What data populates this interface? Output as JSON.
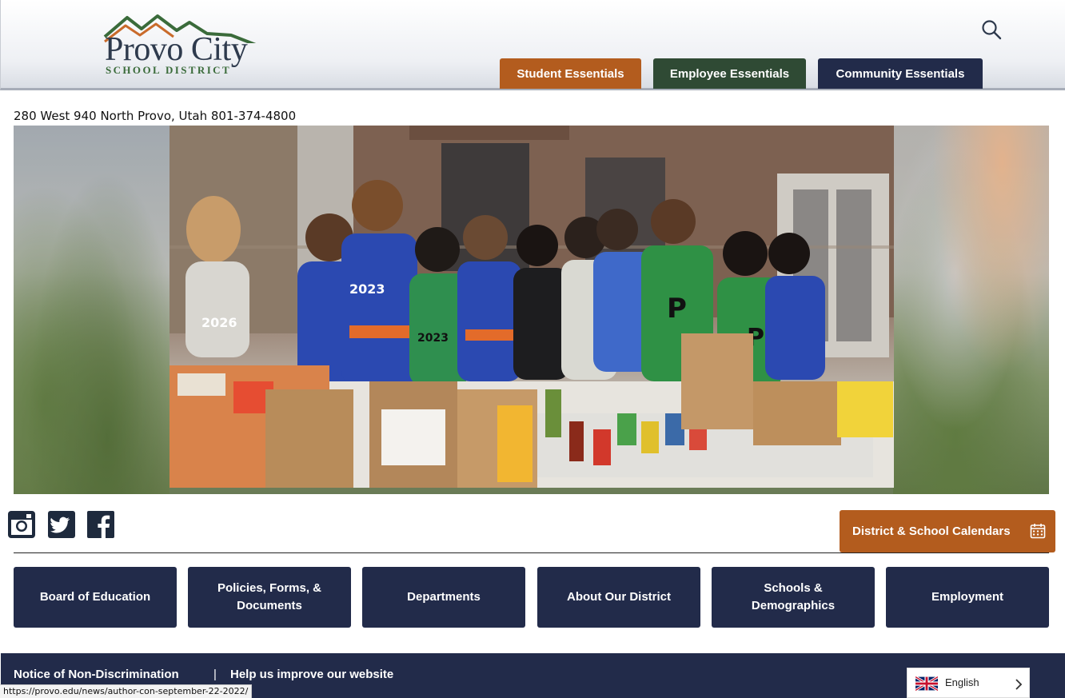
{
  "header": {
    "logo_title": "Provo City",
    "logo_subtitle": "SCHOOL DISTRICT",
    "search_icon": "search-icon",
    "tabs": [
      {
        "label": "Student Essentials",
        "color": "#b35c1e"
      },
      {
        "label": "Employee Essentials",
        "color": "#2f4a34"
      },
      {
        "label": "Community Essentials",
        "color": "#222b4a"
      }
    ]
  },
  "address": "280 West 940 North Provo, Utah 801-374-4800",
  "hero": {
    "image_icon": "photo-students-food-drive",
    "jersey_numbers": [
      "2026",
      "2023",
      "2023"
    ]
  },
  "social": {
    "icons": [
      "instagram-icon",
      "twitter-icon",
      "facebook-icon"
    ]
  },
  "calendar": {
    "label": "District & School Calendars",
    "icon": "calendar-icon"
  },
  "nav_tiles": [
    {
      "label": "Board of Education"
    },
    {
      "label": "Policies, Forms, & Documents"
    },
    {
      "label": "Departments"
    },
    {
      "label": "About Our District"
    },
    {
      "label": "Schools & Demographics"
    },
    {
      "label": "Employment"
    }
  ],
  "footer": {
    "link_1": "Notice of Non-Discrimination",
    "separator": "|",
    "link_2": "Help us improve our website"
  },
  "language": {
    "label": "English",
    "flag_icon": "uk-flag-icon",
    "chevron_icon": "chevron-right-icon"
  },
  "status_bar": {
    "url": "https://provo.edu/news/author-con-september-22-2022/"
  },
  "colors": {
    "brand_orange": "#b35c1e",
    "brand_green": "#2f4a34",
    "brand_navy": "#222b4a"
  }
}
